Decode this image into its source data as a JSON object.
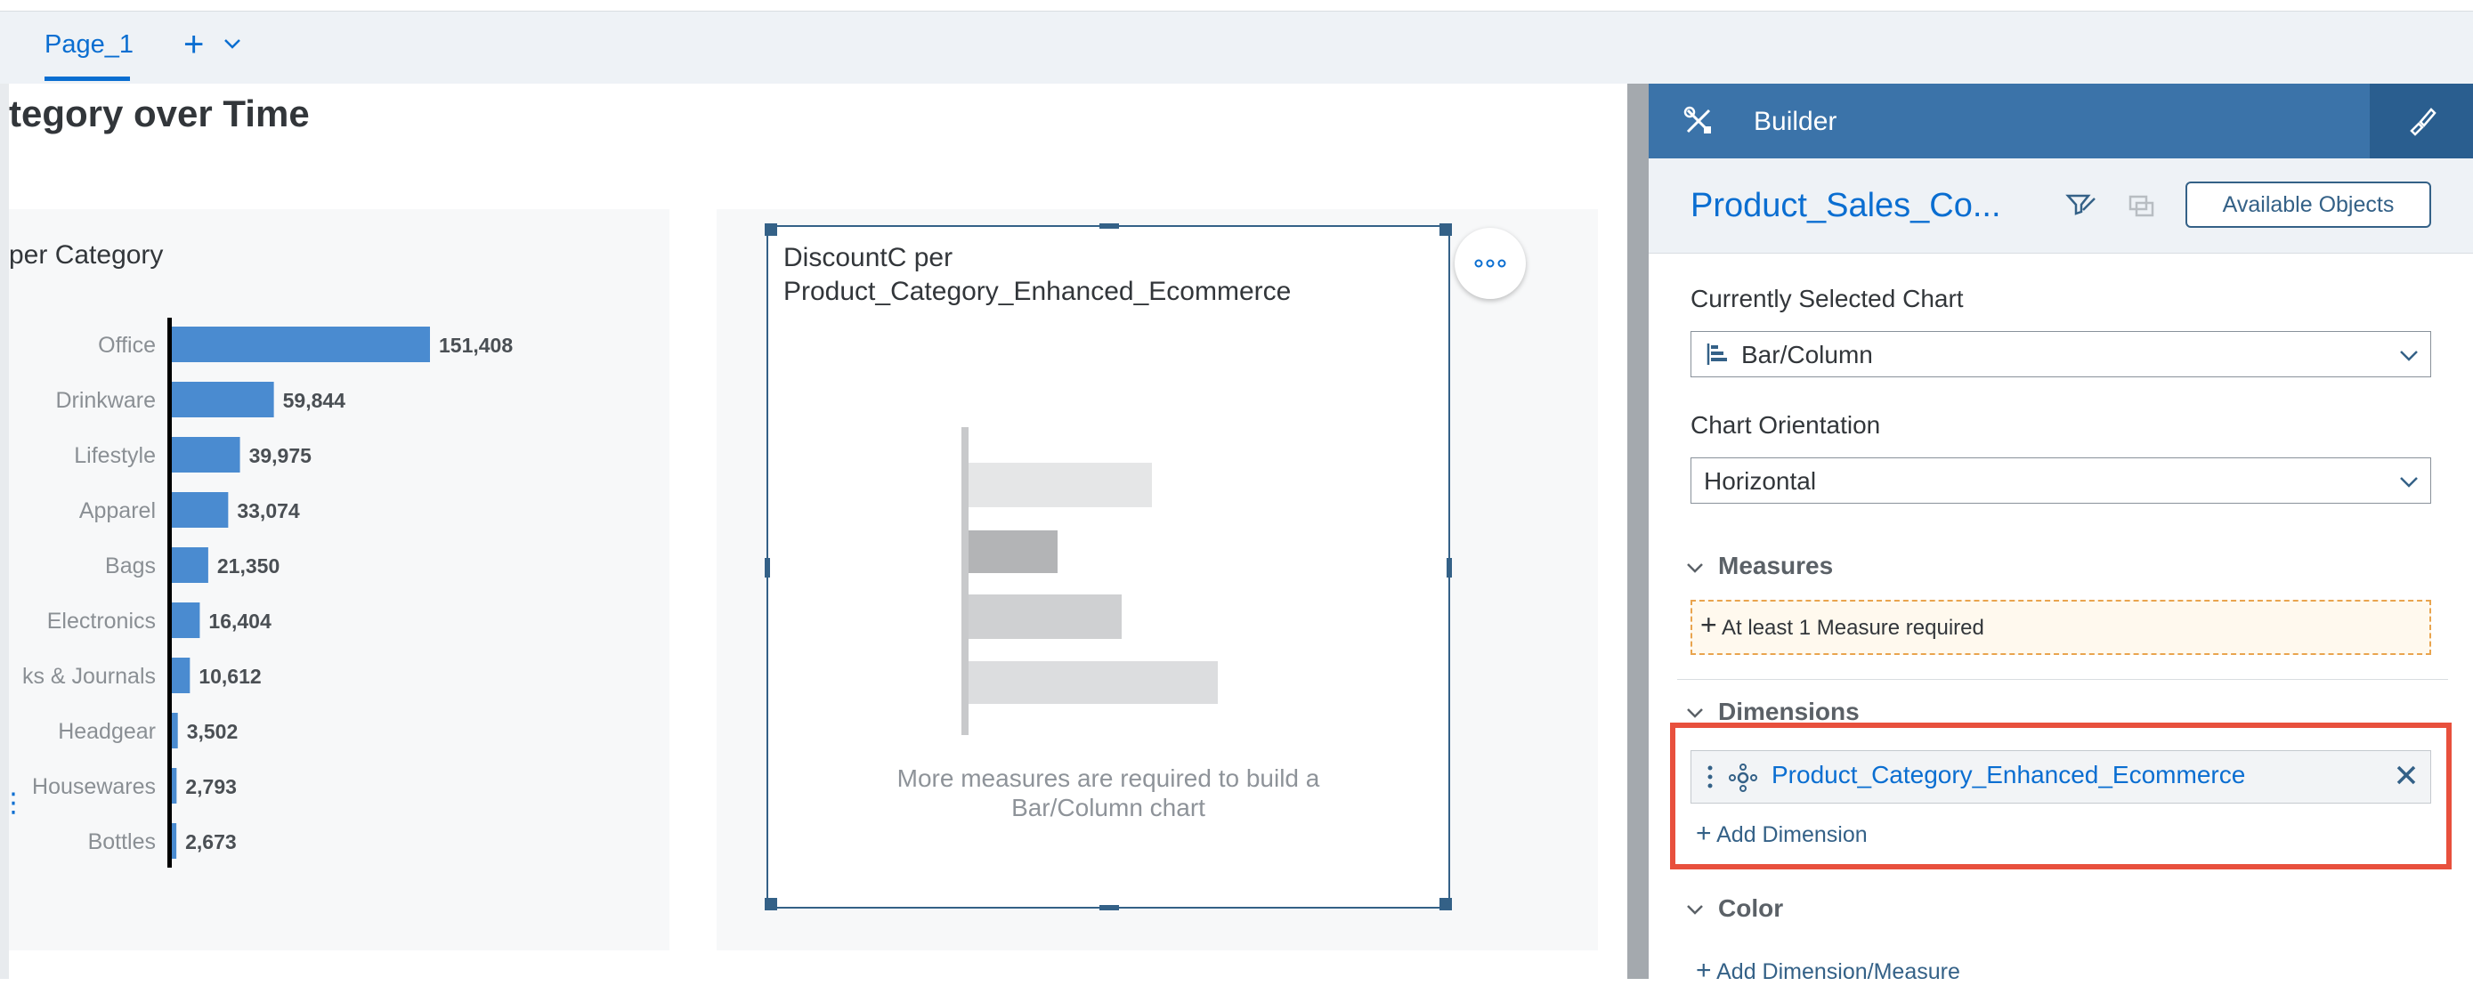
{
  "tabs": {
    "active": "Page_1",
    "add": "+"
  },
  "page": {
    "title_partial": "tegory over Time"
  },
  "chart_left": {
    "title_partial": "per Category",
    "chart_data": {
      "type": "bar",
      "orientation": "horizontal",
      "categories": [
        "Office",
        "Drinkware",
        "Lifestyle",
        "Apparel",
        "Bags",
        "Electronics",
        "ks & Journals",
        "Headgear",
        "Housewares",
        "Bottles"
      ],
      "values": [
        151408,
        59844,
        39975,
        33074,
        21350,
        16404,
        10612,
        3502,
        2793,
        2673
      ],
      "value_labels": [
        "151,408",
        "59,844",
        "39,975",
        "33,074",
        "21,350",
        "16,404",
        "10,612",
        "3,502",
        "2,793",
        "2,673"
      ],
      "bar_color": "#4a8bd0",
      "xlim": [
        0,
        151408
      ]
    }
  },
  "chart_right": {
    "title_line1": "DiscountC per",
    "title_line2": "Product_Category_Enhanced_Ecommerce",
    "placeholder_line1": "More measures are required to build a",
    "placeholder_line2": "Bar/Column chart",
    "more_icon": "ellipsis-icon"
  },
  "builder": {
    "header_title": "Builder",
    "model_name": "Product_Sales_Co...",
    "available_objects": "Available Objects",
    "currently_selected_label": "Currently Selected Chart",
    "currently_selected_value": "Bar/Column",
    "orientation_label": "Chart Orientation",
    "orientation_value": "Horizontal",
    "measures_header": "Measures",
    "measure_required": "At least 1 Measure required",
    "dimensions_header": "Dimensions",
    "dimension_item": "Product_Category_Enhanced_Ecommerce",
    "add_dimension": "Add Dimension",
    "color_header": "Color",
    "add_dimension_measure": "Add Dimension/Measure"
  },
  "colors": {
    "accent": "#0a6ed1",
    "header": "#3b73a9",
    "highlight": "#e8503d",
    "warning": "#e9a44e"
  }
}
